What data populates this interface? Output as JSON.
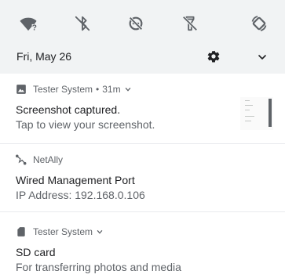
{
  "quick_settings": {
    "tiles": [
      {
        "icon": "wifi-unknown-icon"
      },
      {
        "icon": "bluetooth-off-icon"
      },
      {
        "icon": "do-not-disturb-off-icon"
      },
      {
        "icon": "flashlight-off-icon"
      },
      {
        "icon": "auto-rotate-icon"
      }
    ],
    "date": "Fri, May 26",
    "settings_icon": "gear-icon",
    "expand_icon": "chevron-down-icon"
  },
  "notifications": [
    {
      "app_icon": "image-icon",
      "app_name": "Tester System",
      "time": "31m",
      "title": "Screenshot captured.",
      "text": "Tap to view your screenshot.",
      "has_thumbnail": true
    },
    {
      "app_icon": "network-icon",
      "app_name": "NetAlly",
      "title": "Wired Management Port",
      "text": "IP Address: 192.168.0.106"
    },
    {
      "app_icon": "sd-card-icon",
      "app_name": "Tester System",
      "title": "SD card",
      "text": "For transferring photos and media"
    }
  ],
  "colors": {
    "qs_background": "#f1f3f4",
    "icon": "#5f6368",
    "primary_text": "#202124",
    "secondary_text": "#5f6368"
  }
}
